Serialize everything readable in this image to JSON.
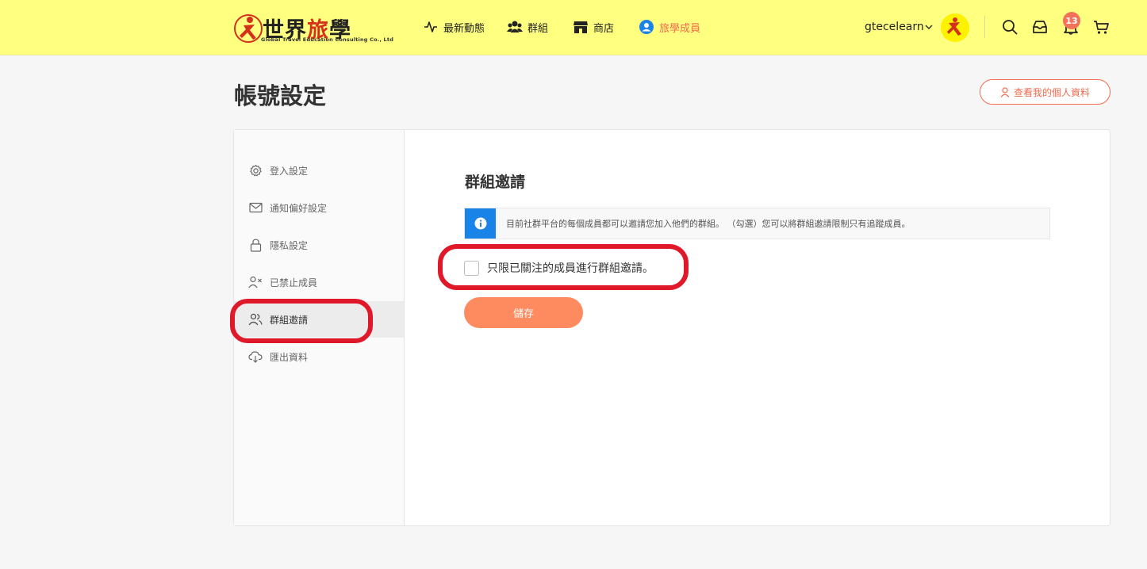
{
  "brand": {
    "name_main": "世界",
    "name_accent": "旅",
    "name_end": "學",
    "subtitle": "Global Travel Education Consulting Co., Ltd"
  },
  "nav": {
    "items": [
      {
        "label": "最新動態",
        "icon": "activity-icon"
      },
      {
        "label": "群組",
        "icon": "group-icon"
      },
      {
        "label": "商店",
        "icon": "shop-icon"
      },
      {
        "label": "旅學成員",
        "icon": "member-icon",
        "active": true
      }
    ]
  },
  "user": {
    "name": "gtecelearn",
    "notification_count": "13"
  },
  "page": {
    "title": "帳號設定",
    "profile_button": "查看我的個人資料"
  },
  "sidebar": {
    "items": [
      {
        "label": "登入設定",
        "icon": "gear-icon"
      },
      {
        "label": "通知偏好設定",
        "icon": "mail-icon"
      },
      {
        "label": "隱私設定",
        "icon": "lock-icon"
      },
      {
        "label": "已禁止成員",
        "icon": "user-block-icon"
      },
      {
        "label": "群組邀請",
        "icon": "users-icon",
        "active": true
      },
      {
        "label": "匯出資料",
        "icon": "cloud-download-icon"
      }
    ]
  },
  "content": {
    "section_title": "群組邀請",
    "info_text": "目前社群平台的每個成員都可以邀請您加入他們的群組。 （勾選）您可以將群組邀請限制只有追蹤成員。",
    "checkbox_label": "只限已關注的成員進行群組邀請。",
    "checkbox_checked": false,
    "save_label": "儲存"
  },
  "colors": {
    "topbar": "#ffff80",
    "accent": "#f26b4d",
    "save_button": "#fd8b5f",
    "info_icon": "#1a83e8",
    "highlight": "#e0192a"
  }
}
